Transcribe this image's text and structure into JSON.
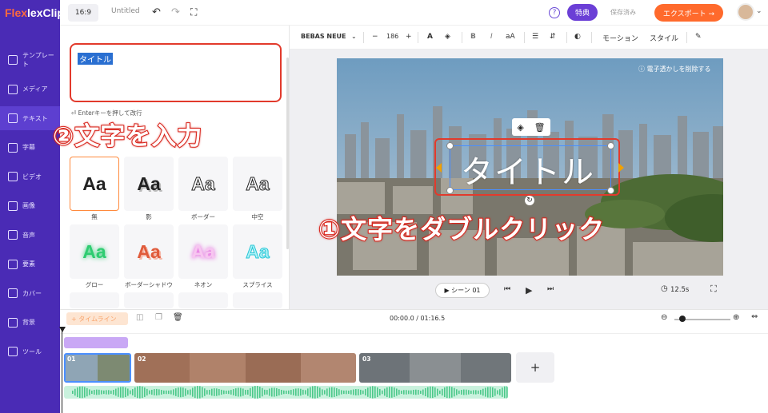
{
  "app": {
    "logo_main": "Flex",
    "logo_accent": "Clip",
    "ratio": "16:9",
    "project_title": "Untitled"
  },
  "topbar": {
    "help": "?",
    "special_label": "特典",
    "saved_label": "保存済み",
    "export_label": "エクスポート →"
  },
  "sidebar": {
    "items": [
      {
        "label": "テンプレート",
        "icon": "template-icon"
      },
      {
        "label": "メディア",
        "icon": "media-icon"
      },
      {
        "label": "テキスト",
        "icon": "text-icon"
      },
      {
        "label": "字幕",
        "icon": "subtitle-icon"
      },
      {
        "label": "ビデオ",
        "icon": "video-icon"
      },
      {
        "label": "画像",
        "icon": "image-icon"
      },
      {
        "label": "音声",
        "icon": "audio-icon"
      },
      {
        "label": "要素",
        "icon": "elements-icon"
      },
      {
        "label": "カバー",
        "icon": "cover-icon"
      },
      {
        "label": "背景",
        "icon": "background-icon"
      },
      {
        "label": "ツール",
        "icon": "tools-icon"
      }
    ]
  },
  "text_toolbar": {
    "font": "BEBAS NEUE",
    "size": "186",
    "motion": "モーション",
    "style": "スタイル"
  },
  "panel": {
    "input_value": "タイトル",
    "hint": "Enterキーを押して改行",
    "styles": [
      {
        "label": "無",
        "sample": "Aa"
      },
      {
        "label": "影",
        "sample": "Aa"
      },
      {
        "label": "ボーダー",
        "sample": "Aa"
      },
      {
        "label": "中空",
        "sample": "Aa"
      },
      {
        "label": "グロー",
        "sample": "Aa"
      },
      {
        "label": "ボーダーシャドウ",
        "sample": "Aa"
      },
      {
        "label": "ネオン",
        "sample": "Aa"
      },
      {
        "label": "スプライス",
        "sample": "Aa"
      }
    ]
  },
  "annotations": {
    "step2": "②文字を入力",
    "step1": "①文字をダブルクリック"
  },
  "canvas": {
    "watermark": "ⓘ 電子透かしを削除する",
    "title_text": "タイトル"
  },
  "player": {
    "scene_label": "▶ シーン 01",
    "duration": "12.5s"
  },
  "timeline": {
    "button_label": "+ タイムライン",
    "timecode": "00:00.0 / 01:16.5",
    "clips": [
      "01",
      "02",
      "03"
    ],
    "add": "+"
  },
  "colors": {
    "sidebar": "#4a2bb5",
    "accent": "#ff6a2c",
    "annotation_red": "#e23a2c",
    "selection": "#4a8fff",
    "audio": "#c9f1dd"
  }
}
